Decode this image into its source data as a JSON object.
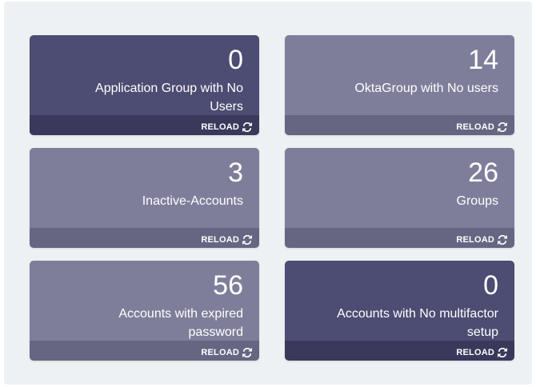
{
  "cards": [
    {
      "count": "0",
      "label": "Application Group with No Users",
      "reload_label": "RELOAD",
      "theme": "dark",
      "icon": "refresh-icon"
    },
    {
      "count": "14",
      "label": "OktaGroup with No users",
      "reload_label": "RELOAD",
      "theme": "light",
      "icon": "refresh-icon"
    },
    {
      "count": "3",
      "label": "Inactive-Accounts",
      "reload_label": "RELOAD",
      "theme": "light",
      "icon": "refresh-icon"
    },
    {
      "count": "26",
      "label": "Groups",
      "reload_label": "RELOAD",
      "theme": "light",
      "icon": "refresh-icon"
    },
    {
      "count": "56",
      "label": "Accounts with expired password",
      "reload_label": "RELOAD",
      "theme": "light",
      "icon": "refresh-icon"
    },
    {
      "count": "0",
      "label": "Accounts with No multifactor setup",
      "reload_label": "RELOAD",
      "theme": "dark",
      "icon": "refresh-icon"
    }
  ],
  "colors": {
    "panel_background": "#eef1f3",
    "card_dark": "#4d4c72",
    "card_light": "#7f7e9a",
    "text": "#ffffff"
  }
}
